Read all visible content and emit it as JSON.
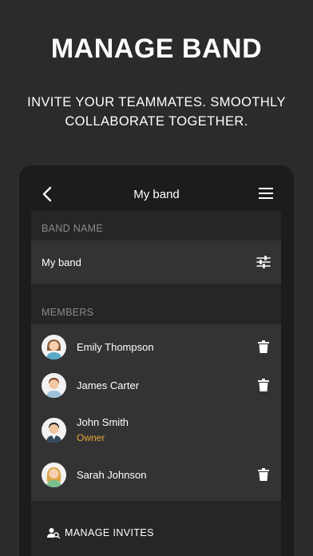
{
  "promo": {
    "headline": "MANAGE BAND",
    "subline": "INVITE YOUR TEAMMATES. SMOOTHLY COLLABORATE TOGETHER."
  },
  "topbar": {
    "title": "My band",
    "back_icon": "chevron-left-icon",
    "menu_icon": "hamburger-menu-icon"
  },
  "band_name": {
    "label": "BAND NAME",
    "value": "My band",
    "edit_icon": "tune-icon"
  },
  "members": {
    "label": "MEMBERS",
    "list": [
      {
        "name": "Emily Thompson",
        "role": "",
        "deletable": true
      },
      {
        "name": "James Carter",
        "role": "",
        "deletable": true
      },
      {
        "name": "John Smith",
        "role": "Owner",
        "deletable": false
      },
      {
        "name": "Sarah Johnson",
        "role": "",
        "deletable": true
      }
    ]
  },
  "invites": {
    "label": "MANAGE INVITES",
    "icon": "person-search-icon"
  },
  "colors": {
    "background": "#2b2b2b",
    "owner_accent": "#e2a93b"
  }
}
